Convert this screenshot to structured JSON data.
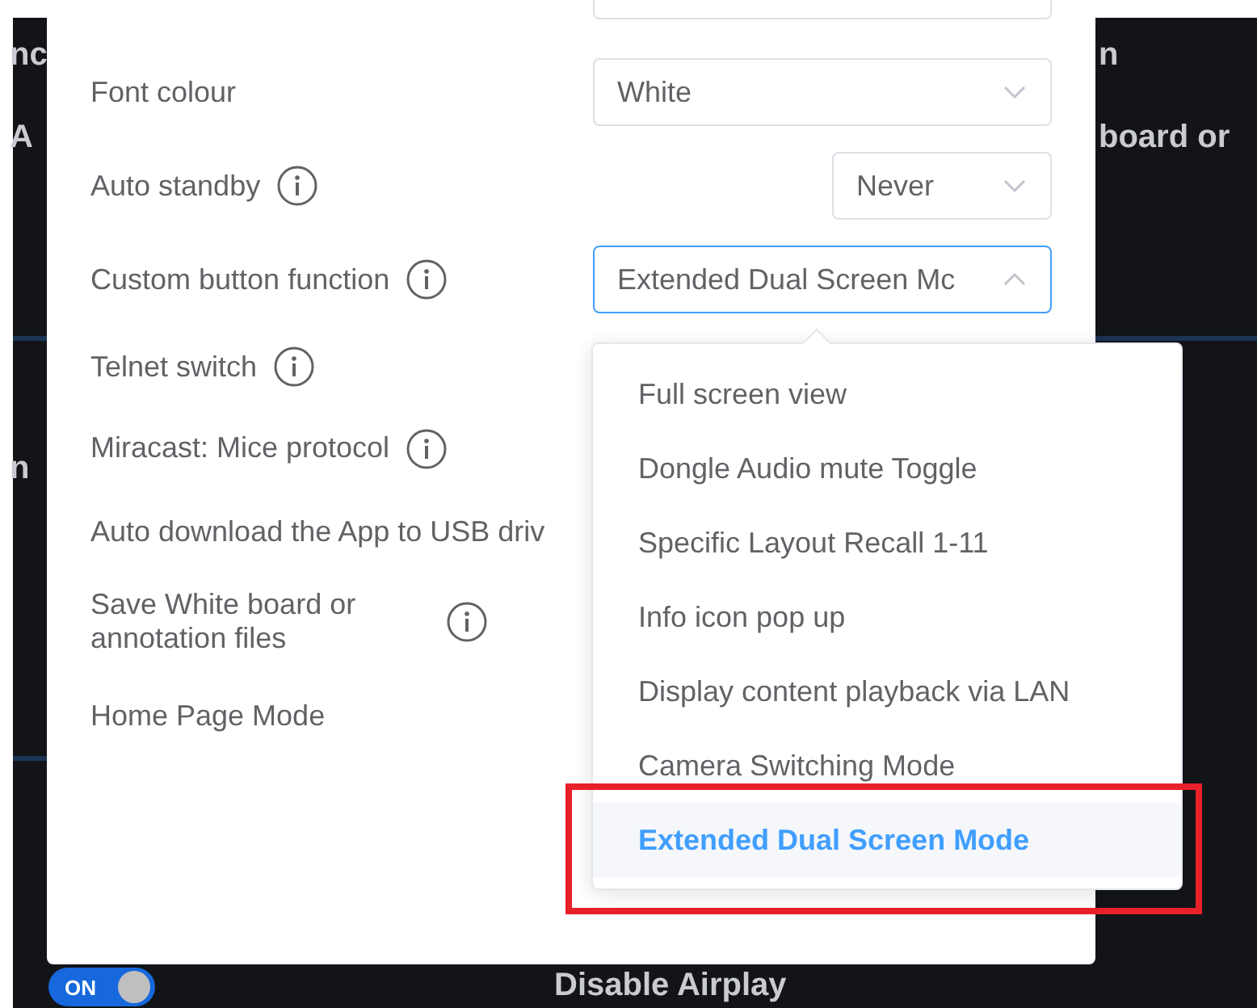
{
  "background": {
    "fragments": [
      {
        "text": "nc"
      },
      {
        "text": "A"
      },
      {
        "text": "n"
      },
      {
        "text": "n"
      },
      {
        "text": "board or"
      },
      {
        "text": "Disable  Airplay"
      }
    ],
    "toggle": {
      "label": "ON",
      "on": true
    }
  },
  "settings": [
    {
      "label": "Font colour",
      "info": false,
      "control": {
        "kind": "select",
        "value": "White",
        "open": false
      }
    },
    {
      "label": "Auto standby",
      "info": true,
      "control": {
        "kind": "short-select",
        "value": "Never",
        "open": false
      }
    },
    {
      "label": "Custom button function",
      "info": true,
      "control": {
        "kind": "select",
        "value": "Extended Dual Screen Mc",
        "open": true
      }
    },
    {
      "label": "Telnet switch",
      "info": true
    },
    {
      "label": "Miracast: Mice protocol",
      "info": true
    },
    {
      "label": "Auto download the App to USB driv",
      "info": false
    },
    {
      "label": "Save White board or annotation files",
      "info": true
    },
    {
      "label": "Home Page Mode",
      "info": false
    }
  ],
  "dropdown": {
    "options": [
      {
        "label": "Full screen view",
        "selected": false
      },
      {
        "label": "Dongle Audio mute Toggle",
        "selected": false
      },
      {
        "label": "Specific Layout Recall 1-11",
        "selected": false
      },
      {
        "label": "Info icon pop up",
        "selected": false
      },
      {
        "label": "Display content playback via LAN",
        "selected": false
      },
      {
        "label": "Camera Switching Mode",
        "selected": false
      },
      {
        "label": "Extended Dual Screen Mode",
        "selected": true
      }
    ]
  }
}
